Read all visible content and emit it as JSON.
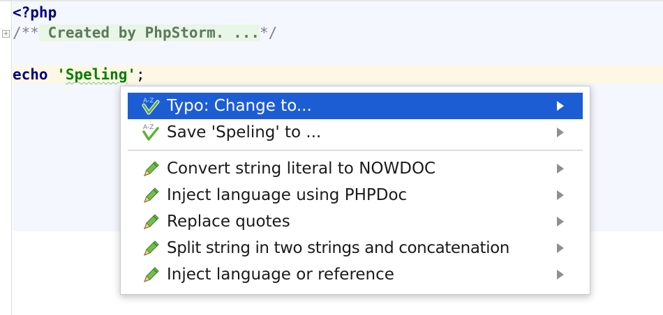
{
  "editor": {
    "lines": {
      "php_open": "<?php",
      "comment_open": "/**",
      "comment_text": " Created by PhpStorm. ...",
      "comment_close": "*/",
      "echo_kw": "echo",
      "string_open": " '",
      "string_word": "Speling",
      "string_close": "'",
      "semicolon": ";"
    }
  },
  "popup": {
    "items": [
      {
        "label": "Typo: Change to...",
        "icon": "spellcheck-icon",
        "selected": true
      },
      {
        "label": "Save 'Speling' to ...",
        "icon": "spellcheck-icon",
        "selected": false
      },
      {
        "label": "Convert string literal to NOWDOC",
        "icon": "intention-pencil-icon",
        "selected": false
      },
      {
        "label": "Inject language using PHPDoc",
        "icon": "intention-pencil-icon",
        "selected": false
      },
      {
        "label": "Replace quotes",
        "icon": "intention-pencil-icon",
        "selected": false
      },
      {
        "label": "Split string in two strings and concatenation",
        "icon": "intention-pencil-icon",
        "selected": false
      },
      {
        "label": "Inject language or reference",
        "icon": "intention-pencil-icon",
        "selected": false
      }
    ]
  },
  "colors": {
    "selection": "#1d5dd4",
    "caret_row": "#fcf8e4",
    "keyword": "#000080",
    "string": "#008000"
  }
}
